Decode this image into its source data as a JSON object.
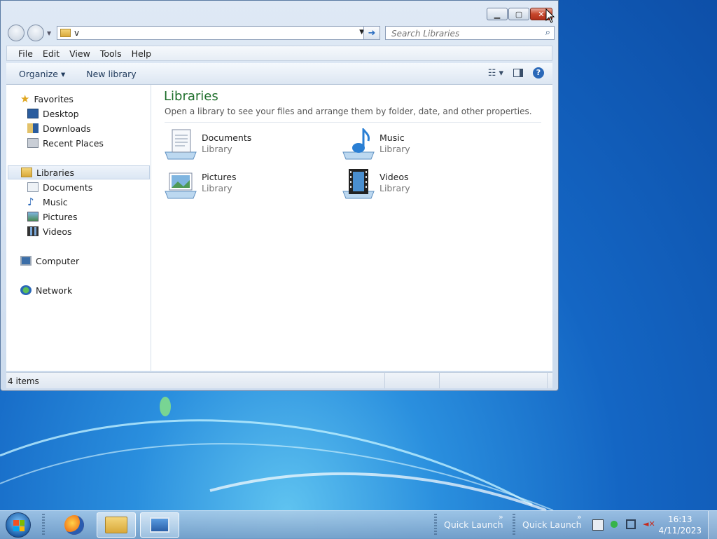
{
  "window": {
    "address_value": "v",
    "search_placeholder": "Search Libraries",
    "menu": [
      "File",
      "Edit",
      "View",
      "Tools",
      "Help"
    ],
    "toolbar": {
      "organize": "Organize ▾",
      "new_library": "New library"
    },
    "nav": {
      "favorites": "Favorites",
      "favorites_items": [
        "Desktop",
        "Downloads",
        "Recent Places"
      ],
      "libraries": "Libraries",
      "libraries_items": [
        "Documents",
        "Music",
        "Pictures",
        "Videos"
      ],
      "computer": "Computer",
      "network": "Network"
    },
    "main": {
      "title": "Libraries",
      "subtitle": "Open a library to see your files and arrange them by folder, date, and other properties.",
      "tiles": [
        {
          "name": "Documents",
          "type": "Library"
        },
        {
          "name": "Music",
          "type": "Library"
        },
        {
          "name": "Pictures",
          "type": "Library"
        },
        {
          "name": "Videos",
          "type": "Library"
        }
      ]
    },
    "status": {
      "count": "4 items"
    }
  },
  "taskbar": {
    "quick_launch_1": "Quick Launch",
    "quick_launch_2": "Quick Launch",
    "time": "16:13",
    "date": "4/11/2023"
  },
  "colors": {
    "accent_title": "#1e6e2b",
    "close_red": "#c7472c",
    "taskbar": "#8fb5da"
  }
}
